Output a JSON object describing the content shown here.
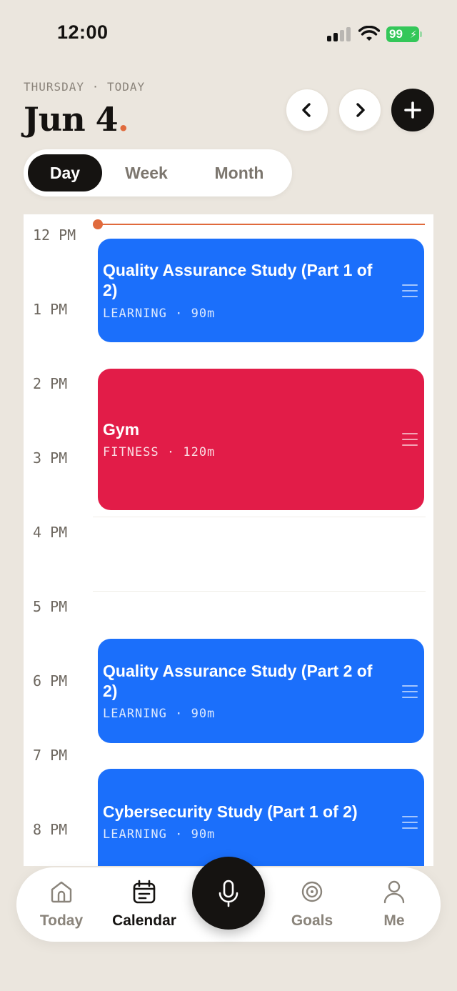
{
  "status": {
    "time": "12:00",
    "battery": "99"
  },
  "header": {
    "day_label": "THURSDAY · TODAY",
    "date": "Jun 4",
    "date_dot": "."
  },
  "controls": {
    "prev": "‹",
    "next": "›",
    "add": "+"
  },
  "tabs": [
    {
      "label": "Day",
      "active": true
    },
    {
      "label": "Week",
      "active": false
    },
    {
      "label": "Month",
      "active": false
    }
  ],
  "hours": [
    "12 PM",
    "1 PM",
    "2 PM",
    "3 PM",
    "4 PM",
    "5 PM",
    "6 PM",
    "7 PM",
    "8 PM"
  ],
  "events": [
    {
      "title": "Quality Assurance Study (Part 1 of 2)",
      "meta": "LEARNING · 90m",
      "color": "#1b6ffb"
    },
    {
      "title": "Gym",
      "meta": "FITNESS · 120m",
      "color": "#e21c48"
    },
    {
      "title": "Quality Assurance Study (Part 2 of 2)",
      "meta": "LEARNING · 90m",
      "color": "#1b6ffb"
    },
    {
      "title": "Cybersecurity Study (Part 1 of 2)",
      "meta": "LEARNING · 90m",
      "color": "#1b6ffb"
    }
  ],
  "nav": {
    "today": "Today",
    "calendar": "Calendar",
    "goals": "Goals",
    "me": "Me",
    "active": "calendar"
  },
  "colors": {
    "accent": "#e06a3c",
    "dark": "#151311",
    "background": "#ebe6de"
  }
}
